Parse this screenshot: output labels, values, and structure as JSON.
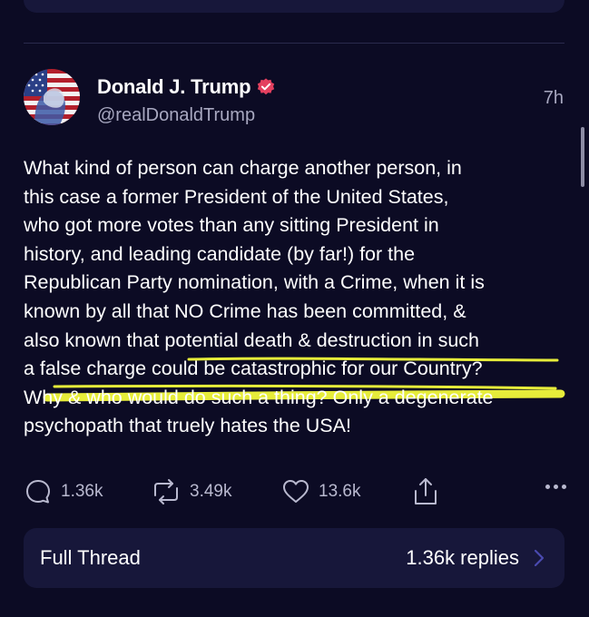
{
  "post": {
    "author_name": "Donald J. Trump",
    "handle": "@realDonaldTrump",
    "time": "7h",
    "text_lines": [
      "What kind of person can charge another person, in",
      "this case a former President of the United States,",
      "who got more votes than any sitting President in",
      "history, and leading candidate (by far!) for the",
      "Republican Party nomination, with a Crime, when it is",
      "known by all that NO Crime has been committed, &",
      "also known that potential death & destruction in such",
      "a false charge could be catastrophic for our Country?",
      "Why & who would do such a thing? Only a degenerate",
      "psychopath that truely hates the USA!"
    ]
  },
  "actions": {
    "replies": "1.36k",
    "reposts": "3.49k",
    "likes": "13.6k"
  },
  "thread": {
    "label": "Full Thread",
    "replies": "1.36k replies"
  },
  "colors": {
    "background": "#0c0b24",
    "card": "#17173a",
    "verified_badge": "#e4405f",
    "highlight": "#e6ec3a"
  },
  "icons": [
    "verified-badge-icon",
    "reply-icon",
    "repost-icon",
    "like-icon",
    "share-icon",
    "more-icon",
    "chevron-right-icon"
  ]
}
